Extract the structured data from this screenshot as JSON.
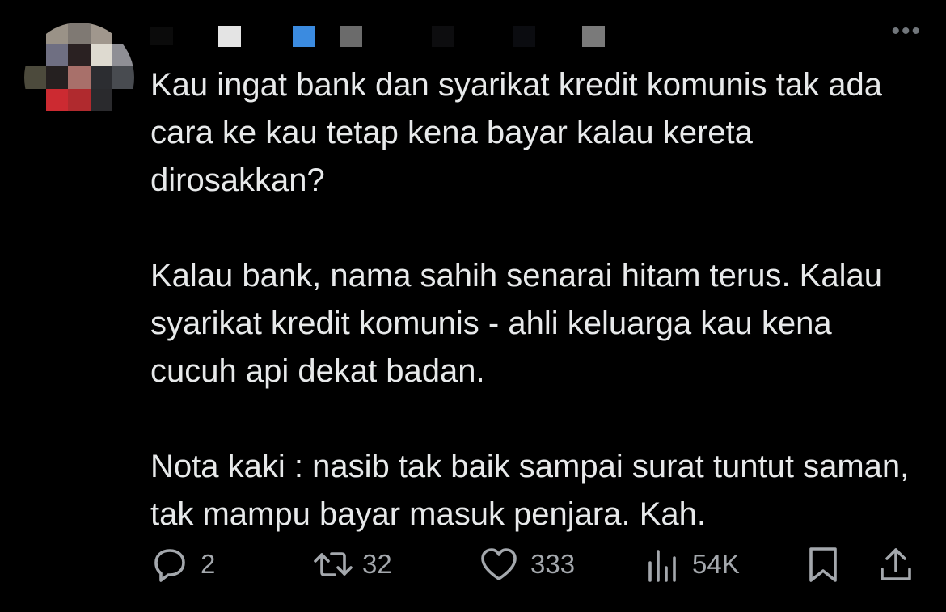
{
  "tweet": {
    "paragraphs": [
      "Kau ingat bank dan syarikat kredit komunis tak ada cara ke kau tetap kena bayar kalau kereta dirosakkan?",
      "Kalau bank, nama sahih senarai hitam terus. Kalau syarikat kredit komunis - ahli keluarga kau kena cucuh api dekat badan.",
      "Nota kaki : nasib tak baik sampai surat tuntut saman, tak mampu bayar masuk penjara. Kah."
    ]
  },
  "more_label": "•••",
  "actions": {
    "reply": {
      "icon": "reply-icon",
      "count": "2"
    },
    "retweet": {
      "icon": "retweet-icon",
      "count": "32"
    },
    "like": {
      "icon": "heart-icon",
      "count": "333"
    },
    "views": {
      "icon": "views-icon",
      "count": "54K"
    },
    "bookmark": {
      "icon": "bookmark-icon"
    },
    "share": {
      "icon": "share-icon"
    }
  },
  "colors": {
    "background": "#000000",
    "text": "#e7e9ea",
    "secondary": "#a4a8ad"
  }
}
